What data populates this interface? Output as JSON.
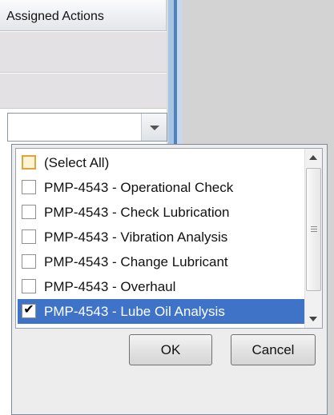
{
  "grid": {
    "column_header": "Assigned Actions"
  },
  "filter_dropdown": {
    "items": [
      {
        "label": "(Select All)",
        "checked": false,
        "partial": true,
        "selected": false
      },
      {
        "label": "PMP-4543 - Operational Check",
        "checked": false,
        "selected": false
      },
      {
        "label": "PMP-4543 - Check Lubrication",
        "checked": false,
        "selected": false
      },
      {
        "label": "PMP-4543 - Vibration Analysis",
        "checked": false,
        "selected": false
      },
      {
        "label": "PMP-4543 - Change Lubricant",
        "checked": false,
        "selected": false
      },
      {
        "label": "PMP-4543 - Overhaul",
        "checked": false,
        "selected": false
      },
      {
        "label": "PMP-4543 - Lube Oil Analysis",
        "checked": true,
        "selected": true
      }
    ],
    "ok_label": "OK",
    "cancel_label": "Cancel",
    "check_glyph": "✔"
  },
  "colors": {
    "selection": "#3f73c7",
    "splitter": "#4f83bf",
    "select_all_border": "#e3a23a"
  }
}
